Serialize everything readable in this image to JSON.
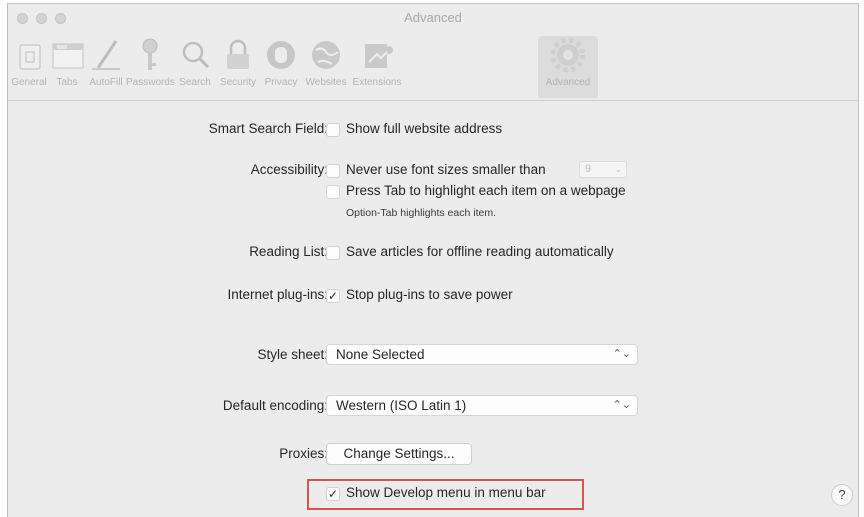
{
  "window": {
    "title": "Advanced"
  },
  "toolbar": {
    "items": [
      {
        "label": "General",
        "icon": "general-switch-icon"
      },
      {
        "label": "Tabs",
        "icon": "tabs-icon"
      },
      {
        "label": "AutoFill",
        "icon": "pencil-icon"
      },
      {
        "label": "Passwords",
        "icon": "key-icon"
      },
      {
        "label": "Search",
        "icon": "magnifier-icon"
      },
      {
        "label": "Security",
        "icon": "lock-icon"
      },
      {
        "label": "Privacy",
        "icon": "hand-icon"
      },
      {
        "label": "Websites",
        "icon": "globe-icon"
      },
      {
        "label": "Extensions",
        "icon": "puzzle-icon"
      },
      {
        "label": "Advanced",
        "icon": "gear-icon"
      }
    ],
    "active": "Advanced"
  },
  "settings": {
    "smart_search": {
      "label": "Smart Search Field:",
      "option": "Show full website address",
      "checked": false
    },
    "accessibility": {
      "label": "Accessibility:",
      "option1": "Never use font sizes smaller than",
      "font_size": "9",
      "option2": "Press Tab to highlight each item on a webpage",
      "note": "Option-Tab highlights each item."
    },
    "reading_list": {
      "label": "Reading List:",
      "option": "Save articles for offline reading automatically"
    },
    "plugins": {
      "label": "Internet plug-ins:",
      "option": "Stop plug-ins to save power",
      "checked": true
    },
    "style_sheet": {
      "label": "Style sheet:",
      "value": "None Selected"
    },
    "encoding": {
      "label": "Default encoding:",
      "value": "Western (ISO Latin 1)"
    },
    "proxies": {
      "label": "Proxies:",
      "button": "Change Settings..."
    },
    "develop": {
      "option": "Show Develop menu in menu bar",
      "checked": true
    }
  },
  "marks": {
    "check": "✓",
    "updown": "⌃⌄",
    "chevron": "⌄",
    "help": "?"
  },
  "colors": {
    "highlight": "#d9534f",
    "icon_gray": "#b9b9b9"
  }
}
